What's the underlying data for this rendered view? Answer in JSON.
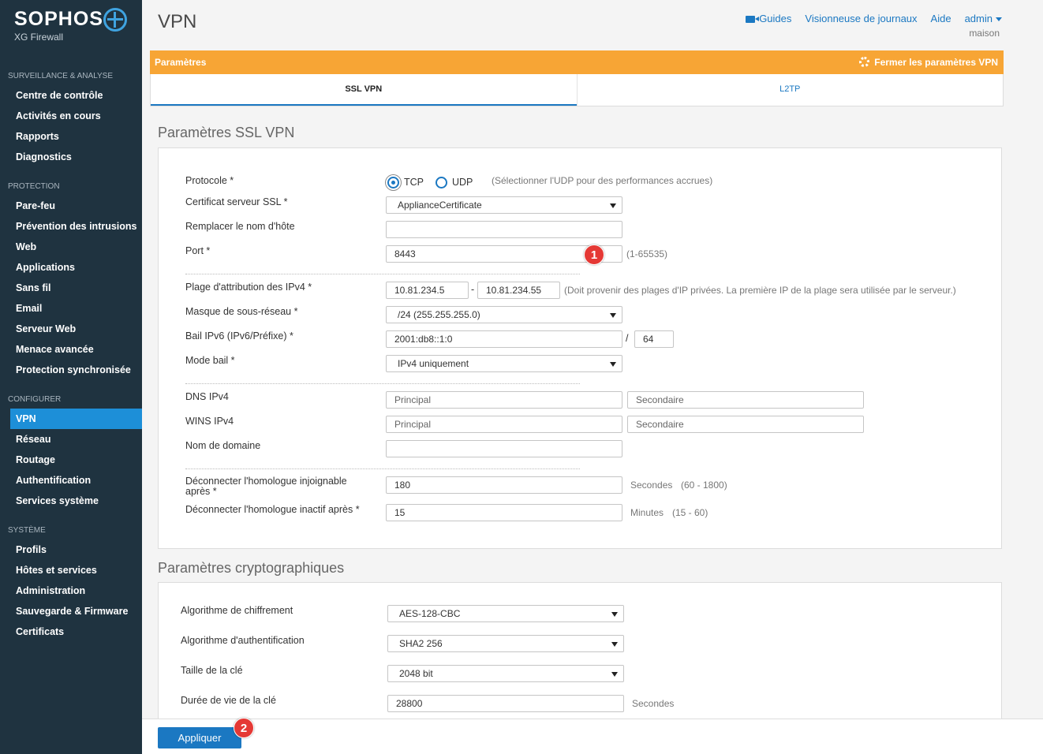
{
  "brand": {
    "name": "SOPHOS",
    "product": "XG Firewall"
  },
  "sidebar": {
    "sections": [
      {
        "title": "SURVEILLANCE & ANALYSE",
        "items": [
          "Centre de contrôle",
          "Activités en cours",
          "Rapports",
          "Diagnostics"
        ]
      },
      {
        "title": "PROTECTION",
        "items": [
          "Pare-feu",
          "Prévention des intrusions",
          "Web",
          "Applications",
          "Sans fil",
          "Email",
          "Serveur Web",
          "Menace avancée",
          "Protection synchronisée"
        ]
      },
      {
        "title": "CONFIGURER",
        "items": [
          "VPN",
          "Réseau",
          "Routage",
          "Authentification",
          "Services système"
        ]
      },
      {
        "title": "SYSTÈME",
        "items": [
          "Profils",
          "Hôtes et services",
          "Administration",
          "Sauvegarde & Firmware",
          "Certificats"
        ]
      }
    ],
    "active_item": "VPN"
  },
  "header": {
    "title": "VPN",
    "links": {
      "guides": "Guides",
      "log_viewer": "Visionneuse de journaux",
      "help": "Aide",
      "user": "admin"
    },
    "org": "maison"
  },
  "settings_bar": {
    "label": "Paramètres",
    "close_label": "Fermer les paramètres VPN"
  },
  "tabs": [
    "SSL VPN",
    "L2TP"
  ],
  "ssl": {
    "heading": "Paramètres SSL VPN",
    "protocol": {
      "label": "Protocole *",
      "tcp": "TCP",
      "udp": "UDP",
      "selected": "TCP",
      "hint": "(Sélectionner l'UDP pour des performances accrues)"
    },
    "cert": {
      "label": "Certificat serveur SSL *",
      "value": "ApplianceCertificate"
    },
    "hostname": {
      "label": "Remplacer le nom d'hôte",
      "value": ""
    },
    "port": {
      "label": "Port *",
      "value": "8443",
      "hint": "(1-65535)"
    },
    "ipv4_range": {
      "label": "Plage d'attribution des IPv4 *",
      "start": "10.81.234.5",
      "dash": "-",
      "end": "10.81.234.55",
      "hint": "(Doit provenir des plages d'IP privées. La première IP de la plage sera utilisée par le serveur.)"
    },
    "subnet": {
      "label": "Masque de sous-réseau *",
      "value": "/24 (255.255.255.0)"
    },
    "ipv6_lease": {
      "label": "Bail IPv6 (IPv6/Préfixe) *",
      "address": "2001:db8::1:0",
      "slash": "/",
      "prefix": "64"
    },
    "lease_mode": {
      "label": "Mode bail *",
      "value": "IPv4 uniquement"
    },
    "dns": {
      "label": "DNS IPv4",
      "primary_placeholder": "Principal",
      "secondary_placeholder": "Secondaire"
    },
    "wins": {
      "label": "WINS IPv4",
      "primary_placeholder": "Principal",
      "secondary_placeholder": "Secondaire"
    },
    "domain": {
      "label": "Nom de domaine",
      "value": ""
    },
    "dead_peer": {
      "label_line1": "Déconnecter l'homologue injoignable",
      "label_line2": "après *",
      "value": "180",
      "unit": "Secondes",
      "range": "(60 - 1800)"
    },
    "idle_peer": {
      "label": "Déconnecter l'homologue inactif après *",
      "value": "15",
      "unit": "Minutes",
      "range": "(15 - 60)"
    }
  },
  "crypto": {
    "heading": "Paramètres cryptographiques",
    "encryption": {
      "label": "Algorithme de chiffrement",
      "value": "AES-128-CBC"
    },
    "auth": {
      "label": "Algorithme d'authentification",
      "value": "SHA2 256"
    },
    "key_size": {
      "label": "Taille de la clé",
      "value": "2048 bit"
    },
    "key_lifetime": {
      "label": "Durée de vie de la clé",
      "value": "28800",
      "unit": "Secondes"
    }
  },
  "badges": {
    "one": "1",
    "two": "2"
  },
  "footer": {
    "apply": "Appliquer"
  },
  "colors": {
    "sidebar": "#1f3340",
    "accent": "#1b78c2",
    "orange": "#f7a535",
    "badge": "#e53935"
  }
}
